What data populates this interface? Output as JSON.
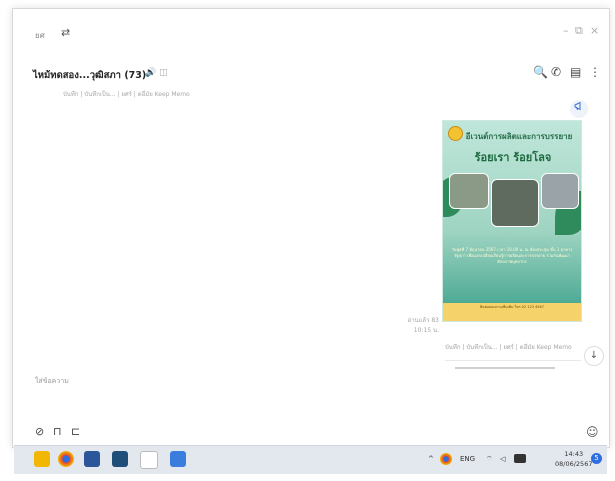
{
  "window": {
    "app_name": "ยศ",
    "settings_glyph": "⇄",
    "controls": {
      "minimize": "–",
      "restore": "⧉",
      "close": "×"
    }
  },
  "chat": {
    "title": "ไหม้ทดสอง...วุฒิสภา (73)",
    "title_icons": "🔊 ◫",
    "header_icons": {
      "search": "🔍",
      "call": "✆",
      "notes": "▤",
      "more": "⋮"
    },
    "notes_bar": "บันทึก | บันทึกเป็น... | ยศร์ | ดอึ่มัย Keep Memo"
  },
  "message": {
    "poster": {
      "title": "อีเวนต์การผลิตและการบรรยาย",
      "subtitle": "ร้อยเรา ร้อยโลจ",
      "body": "วันพุธที่ 7 มิถุนายน 2567 เวลา 10.00 น. ณ ห้องประชุม ชั้น 1 อาคารรัฐสภา เพื่อแลกเปลี่ยนเรียนรู้การผลิตและการบรรยาย ร่วมกันพัฒนาศักยภาพบุคลากร",
      "footer": "ติดต่อสอบถามเพิ่มเติม โทร 02 123 4567"
    },
    "meta_read": "อ่านแล้ว 83",
    "meta_time": "10:15 น.",
    "notes": "บันทึก | บันทึกเป็น... | ยศร์ | ดอึ่มัย Keep Memo"
  },
  "composer": {
    "placeholder": "ใส่ข้อความ",
    "tools": {
      "attach": "⊘",
      "bookmark": "⊓",
      "crop": "⊏"
    },
    "emoji": "☺"
  },
  "taskbar": {
    "tray_up": "^",
    "lang": "ENG",
    "wifi": "⌔",
    "sound": "◁",
    "clock_time": "14:43",
    "clock_date": "08/06/2567",
    "badge": "5"
  },
  "colors": {
    "poster_bg": "#bfe6da",
    "poster_footer": "#f6d36a",
    "taskbar_bg": "#e3e7ee",
    "accent_blue": "#3b6fd1"
  }
}
